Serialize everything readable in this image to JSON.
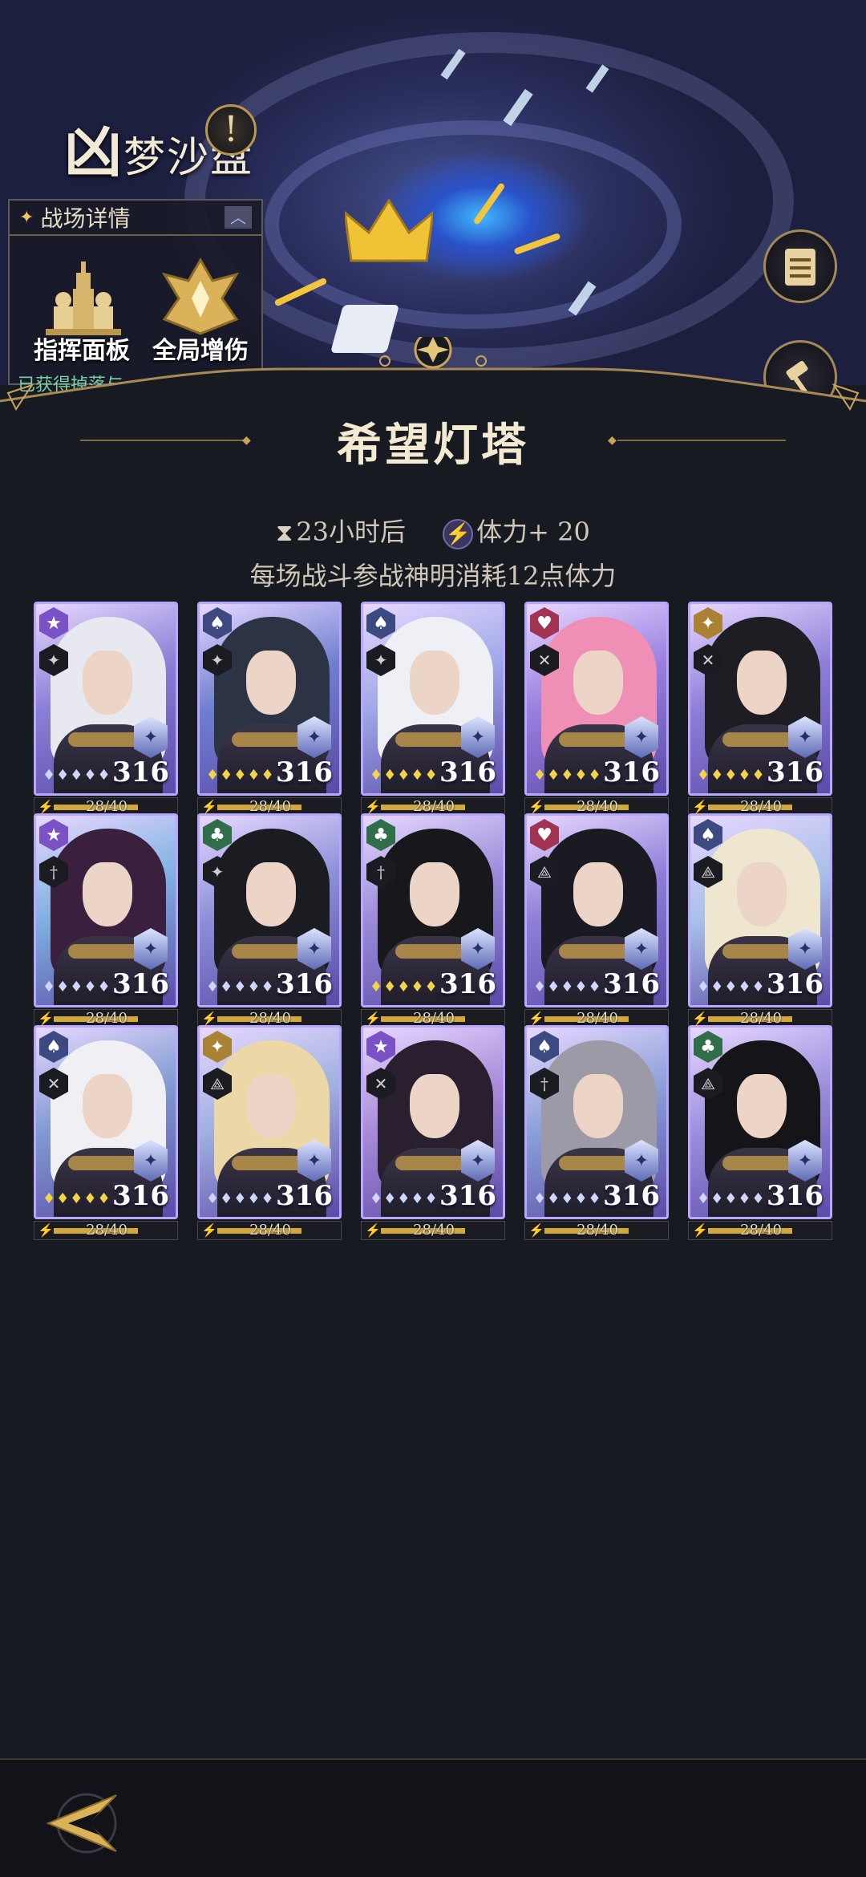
{
  "stage": {
    "title_big": "凶",
    "title_rest": "梦沙盘",
    "alert_glyph": "!"
  },
  "battle_panel": {
    "title": "战场详情",
    "items": [
      {
        "label": "指挥面板",
        "icon": "chess-pieces-icon"
      },
      {
        "label": "全局增伤",
        "icon": "golden-crest-icon"
      }
    ],
    "footer": "已获得掉落与"
  },
  "side_buttons": [
    {
      "icon": "scroll-list-icon"
    },
    {
      "icon": "gavel-icon"
    }
  ],
  "main": {
    "title": "希望灯塔",
    "timer": "23小时后",
    "stamina_bonus": "体力+ 20",
    "note": "每场战斗参战神明消耗12点体力"
  },
  "cards": [
    {
      "suit": "★",
      "suit_color": "#7b52c6",
      "role": "✦",
      "level": "316",
      "gems": "♦♦♦♦♦",
      "gem_color": "#cfd6ff",
      "stamina": "28/40",
      "stamina_ratio": 0.7,
      "hair": "#e8e8f0",
      "sky": "#8a7fd6"
    },
    {
      "suit": "♠",
      "suit_color": "#3d4a82",
      "role": "✦",
      "level": "316",
      "gems": "♦♦♦♦♦",
      "gem_color": "#f3d34a",
      "stamina": "28/40",
      "stamina_ratio": 0.7,
      "hair": "#2c3344",
      "sky": "#6f7fd0"
    },
    {
      "suit": "♠",
      "suit_color": "#3d4a82",
      "role": "✦",
      "level": "316",
      "gems": "♦♦♦♦♦",
      "gem_color": "#f3d34a",
      "stamina": "28/40",
      "stamina_ratio": 0.7,
      "hair": "#eef0f6",
      "sky": "#9fa8e8"
    },
    {
      "suit": "♥",
      "suit_color": "#a23352",
      "role": "✕",
      "level": "316",
      "gems": "♦♦♦♦♦",
      "gem_color": "#f3d34a",
      "stamina": "28/40",
      "stamina_ratio": 0.7,
      "hair": "#ef8fb6",
      "sky": "#9a7fe0"
    },
    {
      "suit": "✦",
      "suit_color": "#a98233",
      "role": "✕",
      "level": "316",
      "gems": "♦♦♦♦♦",
      "gem_color": "#f3d34a",
      "stamina": "28/40",
      "stamina_ratio": 0.7,
      "hair": "#1e1d24",
      "sky": "#8f7ed8"
    },
    {
      "suit": "★",
      "suit_color": "#7b52c6",
      "role": "†",
      "level": "316",
      "gems": "♦♦♦♦♦",
      "gem_color": "#cfd6ff",
      "stamina": "28/40",
      "stamina_ratio": 0.7,
      "hair": "#3a1f3e",
      "sky": "#7fb0e0"
    },
    {
      "suit": "♣",
      "suit_color": "#2f6e49",
      "role": "✦",
      "level": "316",
      "gems": "♦♦♦♦♦",
      "gem_color": "#cfd6ff",
      "stamina": "28/40",
      "stamina_ratio": 0.7,
      "hair": "#1b1c22",
      "sky": "#8a8fd8"
    },
    {
      "suit": "♣",
      "suit_color": "#2f6e49",
      "role": "†",
      "level": "316",
      "gems": "♦♦♦♦♦",
      "gem_color": "#f3d34a",
      "stamina": "28/40",
      "stamina_ratio": 0.7,
      "hair": "#17171c",
      "sky": "#9a8ad8"
    },
    {
      "suit": "♥",
      "suit_color": "#a23352",
      "role": "⟁",
      "level": "316",
      "gems": "♦♦♦♦♦",
      "gem_color": "#cfd6ff",
      "stamina": "28/40",
      "stamina_ratio": 0.7,
      "hair": "#1a1a22",
      "sky": "#8f7ed8"
    },
    {
      "suit": "♠",
      "suit_color": "#3d4a82",
      "role": "⟁",
      "level": "316",
      "gems": "♦♦♦♦♦",
      "gem_color": "#cfd6ff",
      "stamina": "28/40",
      "stamina_ratio": 0.7,
      "hair": "#efe6d0",
      "sky": "#a8bfe8"
    },
    {
      "suit": "♠",
      "suit_color": "#3d4a82",
      "role": "✕",
      "level": "316",
      "gems": "♦♦♦♦♦",
      "gem_color": "#f3d34a",
      "stamina": "28/40",
      "stamina_ratio": 0.7,
      "hair": "#f0f0f4",
      "sky": "#7f9ad0"
    },
    {
      "suit": "✦",
      "suit_color": "#a98233",
      "role": "⟁",
      "level": "316",
      "gems": "♦♦♦♦♦",
      "gem_color": "#cfd6ff",
      "stamina": "28/40",
      "stamina_ratio": 0.7,
      "hair": "#ecd8a6",
      "sky": "#9fb0e0"
    },
    {
      "suit": "★",
      "suit_color": "#7b52c6",
      "role": "✕",
      "level": "316",
      "gems": "♦♦♦♦♦",
      "gem_color": "#cfd6ff",
      "stamina": "28/40",
      "stamina_ratio": 0.7,
      "hair": "#2a1f2e",
      "sky": "#a88ad8"
    },
    {
      "suit": "♠",
      "suit_color": "#3d4a82",
      "role": "†",
      "level": "316",
      "gems": "♦♦♦♦♦",
      "gem_color": "#cfd6ff",
      "stamina": "28/40",
      "stamina_ratio": 0.7,
      "hair": "#9c9aa6",
      "sky": "#8aa0d8"
    },
    {
      "suit": "♣",
      "suit_color": "#2f6e49",
      "role": "⟁",
      "level": "316",
      "gems": "♦♦♦♦♦",
      "gem_color": "#cfd6ff",
      "stamina": "28/40",
      "stamina_ratio": 0.7,
      "hair": "#151519",
      "sky": "#9c8edc"
    }
  ],
  "bottom": {
    "back_icon": "back-arrow-icon"
  }
}
